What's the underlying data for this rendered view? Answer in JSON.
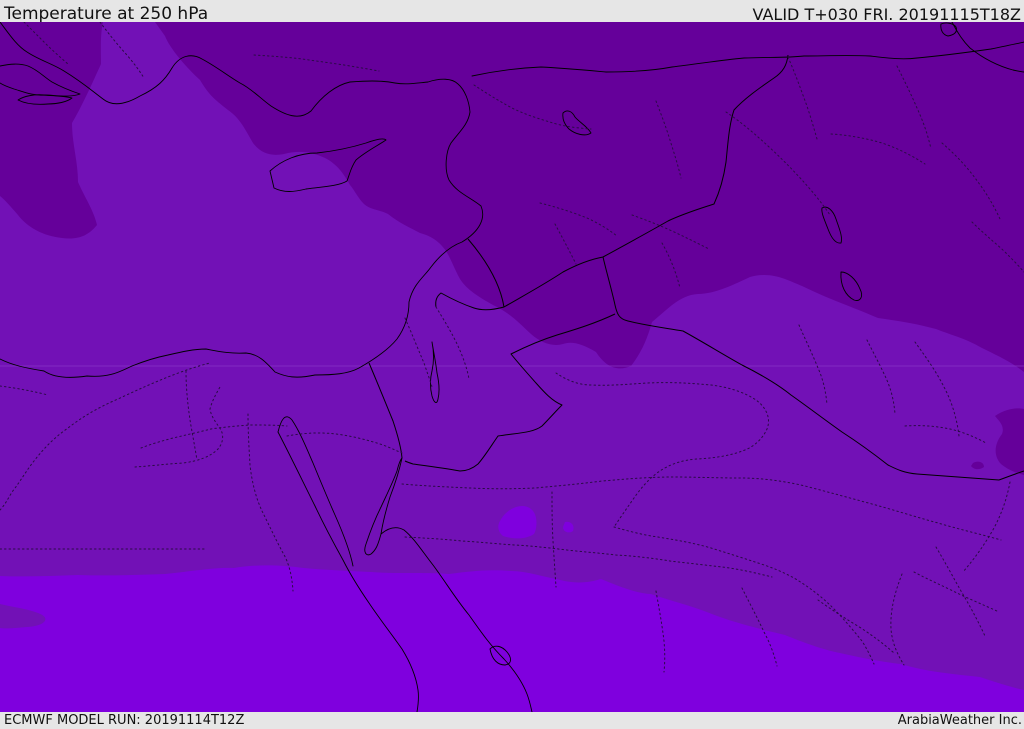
{
  "header": {
    "title": "Temperature at 250 hPa",
    "valid_text": "VALID T+030 FRI. 20191115T18Z"
  },
  "footer": {
    "model_run": "ECMWF MODEL RUN: 20191114T12Z",
    "brand": "ArabiaWeather Inc."
  },
  "map": {
    "colors": {
      "dark_band": "#65009a",
      "mid_band": "#7211b6",
      "light_band": "#7f00de",
      "background_frame": "#e6e6e6",
      "lines": "#000000"
    }
  }
}
